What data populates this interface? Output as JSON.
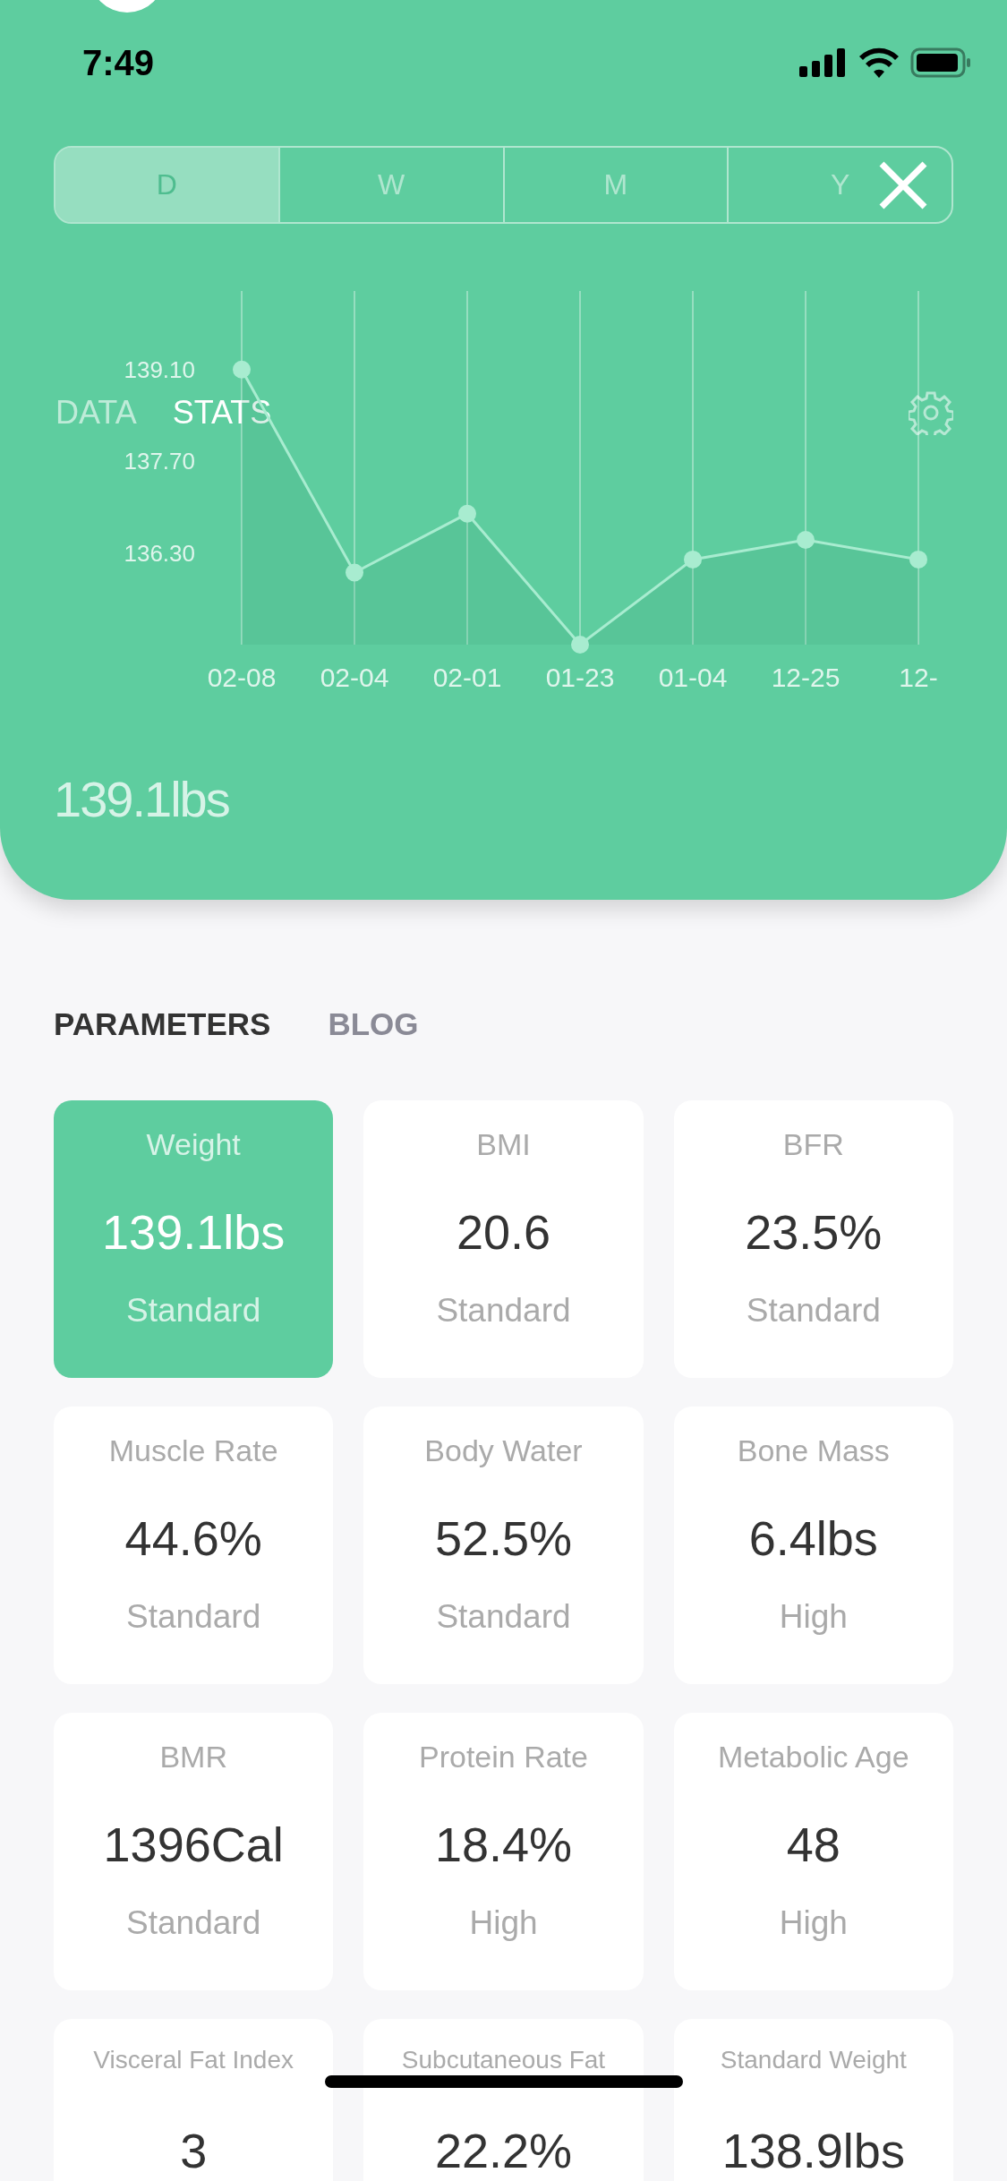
{
  "status_bar": {
    "time": "7:49"
  },
  "period_tabs": [
    {
      "label": "D",
      "selected": true
    },
    {
      "label": "W",
      "selected": false
    },
    {
      "label": "M",
      "selected": false
    },
    {
      "label": "Y",
      "selected": false
    }
  ],
  "view_tabs": [
    {
      "label": "DATA",
      "selected": false
    },
    {
      "label": "STATS",
      "selected": true
    }
  ],
  "chart_data": {
    "type": "area",
    "grid": true,
    "categories": [
      "02-08",
      "02-04",
      "02-01",
      "01-23",
      "01-04",
      "12-25",
      "12-"
    ],
    "series": [
      {
        "color": "#a8ecd0",
        "values": [
          139.1,
          136.0,
          136.9,
          134.9,
          136.2,
          136.5,
          136.2
        ]
      }
    ],
    "ylim": [
      134.9,
      140.3
    ],
    "yticks": [
      {
        "value": 139.1,
        "label": "139.10"
      },
      {
        "value": 137.7,
        "label": "137.70"
      },
      {
        "value": 136.3,
        "label": "136.30"
      }
    ]
  },
  "current_reading": "139.1lbs",
  "section_tabs": [
    {
      "label": "PARAMETERS",
      "selected": true
    },
    {
      "label": "BLOG",
      "selected": false
    }
  ],
  "metrics": [
    {
      "title": "Weight",
      "value": "139.1lbs",
      "status": "Standard",
      "selected": true
    },
    {
      "title": "BMI",
      "value": "20.6",
      "status": "Standard",
      "selected": false
    },
    {
      "title": "BFR",
      "value": "23.5%",
      "status": "Standard",
      "selected": false
    },
    {
      "title": "Muscle Rate",
      "value": "44.6%",
      "status": "Standard",
      "selected": false
    },
    {
      "title": "Body Water",
      "value": "52.5%",
      "status": "Standard",
      "selected": false
    },
    {
      "title": "Bone Mass",
      "value": "6.4lbs",
      "status": "High",
      "selected": false
    },
    {
      "title": "BMR",
      "value": "1396Cal",
      "status": "Standard",
      "selected": false
    },
    {
      "title": "Protein Rate",
      "value": "18.4%",
      "status": "High",
      "selected": false
    },
    {
      "title": "Metabolic Age",
      "value": "48",
      "status": "High",
      "selected": false
    },
    {
      "title": "Visceral Fat Index",
      "value": "3",
      "selected": false
    },
    {
      "title": "Subcutaneous Fat",
      "value": "22.2%",
      "selected": false
    },
    {
      "title": "Standard Weight",
      "value": "138.9lbs",
      "selected": false
    }
  ]
}
